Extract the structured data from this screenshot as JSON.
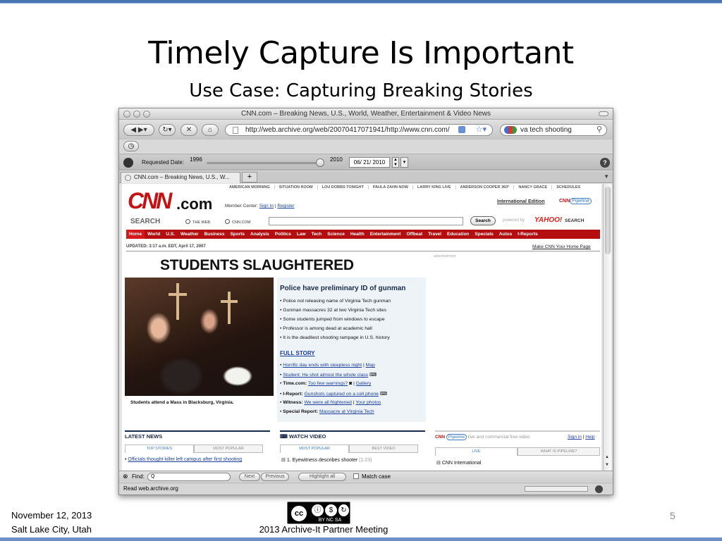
{
  "slide": {
    "title": "Timely Capture Is Important",
    "subtitle": "Use Case: Capturing Breaking Stories",
    "date": "November 12, 2013",
    "location": "Salt Lake City, Utah",
    "meeting": "2013 Archive-It Partner Meeting",
    "page_number": "5",
    "license_icon": "cc-by-nc-sa-icon",
    "license_text": "BY NC SA",
    "colors": {
      "top_bar": "#4a74b4",
      "bottom_bar": "#6c8fc7"
    }
  },
  "browser": {
    "window_title": "CNN.com – Breaking News, U.S., World, Weather, Entertainment & Video News",
    "address": "http://web.archive.org/web/20070417071941/http://www.cnn.com/",
    "search_value": "va tech shooting",
    "requested_date_label": "Requested Date:",
    "year_start": "1996",
    "year_end": "2010",
    "date_value": "06/ 21/ 2010",
    "tab_label": "CNN.com – Breaking News, U.S., W...",
    "find_label": "Find:",
    "find_value": "Q",
    "find_next": "Next",
    "find_previous": "Previous",
    "find_highlight": "Highlight all",
    "find_match_case": "Match case",
    "status": "Read web.archive.org"
  },
  "cnn": {
    "logo": "CNN",
    "logo_suffix": ".com",
    "top_nav": [
      "AMERICAN MORNING",
      "SITUATION ROOM",
      "LOU DOBBS TONIGHT",
      "PAULA ZAHN NOW",
      "LARRY KING LIVE",
      "ANDERSON COOPER 360°",
      "NANCY GRACE",
      "SCHEDULES"
    ],
    "member_center": "Member Center:",
    "sign_in": "Sign In",
    "register": "Register",
    "international_edition": "International Edition",
    "pipeline_brand": "CNN",
    "pipeline_word": "Pipeline",
    "search_label": "SEARCH",
    "radio_web": "THE WEB",
    "radio_cnn": "CNN.COM",
    "search_button": "Search",
    "powered_by": "powered by",
    "yahoo": "YAHOO!",
    "yahoo_search": "SEARCH",
    "main_nav": [
      "Home",
      "World",
      "U.S.",
      "Weather",
      "Business",
      "Sports",
      "Analysis",
      "Politics",
      "Law",
      "Tech",
      "Science",
      "Health",
      "Entertainment",
      "Offbeat",
      "Travel",
      "Education",
      "Specials",
      "Autos",
      "I-Reports"
    ],
    "updated": "UPDATED: 3:17 a.m. EDT, April 17, 2007",
    "make_home": "Make CNN Your Home Page",
    "headline": "STUDENTS SLAUGHTERED",
    "photo_caption": "Students attend a Mass in Blacksburg, Virginia.",
    "story_heading": "Police have preliminary ID of gunman",
    "bullets": [
      "Police not releasing name of Virginia Tech gunman",
      "Gunman massacres 32 at two Virginia Tech sites",
      "Some students jumped from windows to escape",
      "Professor is among dead at academic hall",
      "It is the deadliest shooting rampage in U.S. history"
    ],
    "full_story": "FULL STORY",
    "links": {
      "l1a": "Horrific day ends with sleepless night",
      "l1b": "Map",
      "l2": "Student: He shot almost the whole class",
      "l3_prefix": "Time.com:",
      "l3a": "Too few warnings?",
      "l3b": "Gallery",
      "l4_prefix": "I-Report:",
      "l4": "Gunshots captured on a cell phone",
      "l5_prefix": "Witness:",
      "l5a": "We were all frightened",
      "l5b": "Your photos",
      "l6_prefix": "Special Report:",
      "l6": "Massacre at Virginia Tech"
    },
    "advertisement": "advertisement",
    "latest_news": "LATEST NEWS",
    "latest_tabs": [
      "TOP STORIES",
      "MOST POPULAR"
    ],
    "latest_item": "Officials thought killer left campus after first shooting",
    "watch_video": "WATCH VIDEO",
    "video_tabs": [
      "MOST POPULAR",
      "BEST VIDEO"
    ],
    "video_item": "1. Eyewitness describes shooter",
    "video_duration": "(1:23)",
    "pipeline_tagline": "live and commercial free video",
    "pipeline_sign_in": "Sign in",
    "pipeline_help": "Help",
    "pipeline_tabs": [
      "LIVE",
      "WHAT IS PIPELINE?"
    ],
    "pipeline_item": "CNN International"
  }
}
